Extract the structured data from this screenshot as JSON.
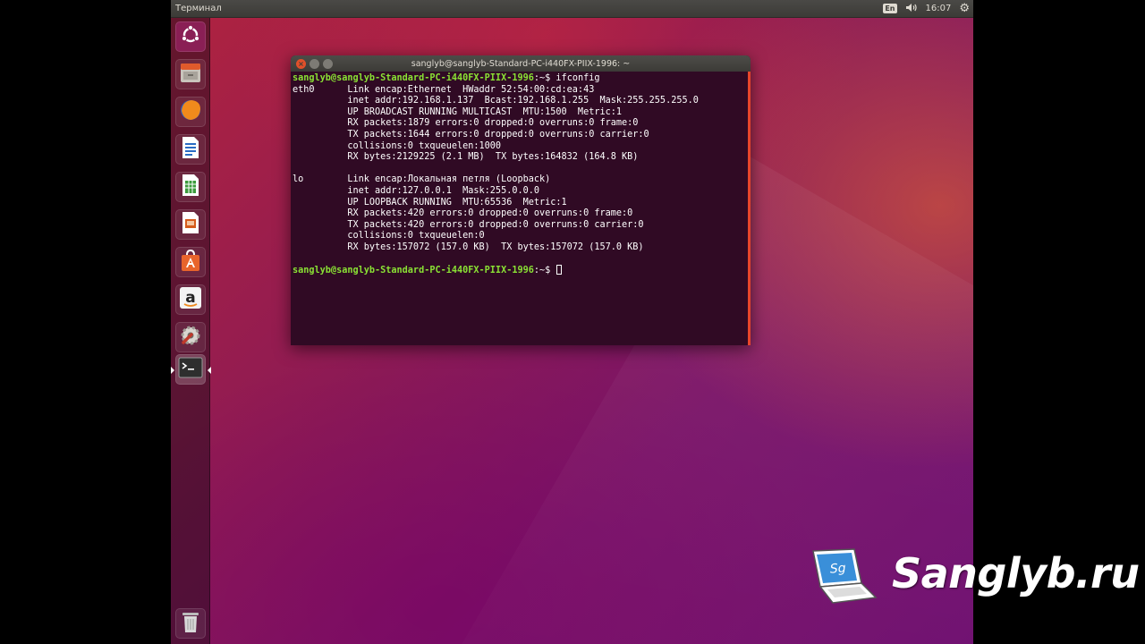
{
  "top_panel": {
    "app_title": "Терминал",
    "keyboard_layout": "En",
    "clock": "16:07"
  },
  "launcher": {
    "items": [
      {
        "name": "dash-home",
        "icon": "ubuntu-logo-icon"
      },
      {
        "name": "files",
        "icon": "file-cabinet-icon"
      },
      {
        "name": "firefox",
        "icon": "firefox-icon"
      },
      {
        "name": "writer",
        "icon": "libreoffice-writer-icon"
      },
      {
        "name": "calc",
        "icon": "libreoffice-calc-icon"
      },
      {
        "name": "impress",
        "icon": "libreoffice-impress-icon"
      },
      {
        "name": "software-center",
        "icon": "shopping-bag-icon"
      },
      {
        "name": "amazon",
        "icon": "amazon-icon"
      },
      {
        "name": "system-settings",
        "icon": "wrench-gear-icon"
      },
      {
        "name": "terminal",
        "icon": "terminal-icon"
      },
      {
        "name": "trash",
        "icon": "trash-icon"
      }
    ]
  },
  "terminal": {
    "title": "sanglyb@sanglyb-Standard-PC-i440FX-PIIX-1996: ~",
    "prompt": "sanglyb@sanglyb-Standard-PC-i440FX-PIIX-1996",
    "prompt_suffix": ":~$ ",
    "command": "ifconfig",
    "output": [
      "eth0      Link encap:Ethernet  HWaddr 52:54:00:cd:ea:43",
      "          inet addr:192.168.1.137  Bcast:192.168.1.255  Mask:255.255.255.0",
      "          UP BROADCAST RUNNING MULTICAST  MTU:1500  Metric:1",
      "          RX packets:1879 errors:0 dropped:0 overruns:0 frame:0",
      "          TX packets:1644 errors:0 dropped:0 overruns:0 carrier:0",
      "          collisions:0 txqueuelen:1000",
      "          RX bytes:2129225 (2.1 MB)  TX bytes:164832 (164.8 KB)",
      "",
      "lo        Link encap:Локальная петля (Loopback)",
      "          inet addr:127.0.0.1  Mask:255.0.0.0",
      "          UP LOOPBACK RUNNING  MTU:65536  Metric:1",
      "          RX packets:420 errors:0 dropped:0 overruns:0 frame:0",
      "          TX packets:420 errors:0 dropped:0 overruns:0 carrier:0",
      "          collisions:0 txqueuelen:0",
      "          RX bytes:157072 (157.0 KB)  TX bytes:157072 (157.0 KB)",
      ""
    ]
  },
  "watermark": {
    "text": "Sanglyb.ru",
    "logo_text": "Sg",
    "icon": "laptop-logo-icon"
  }
}
